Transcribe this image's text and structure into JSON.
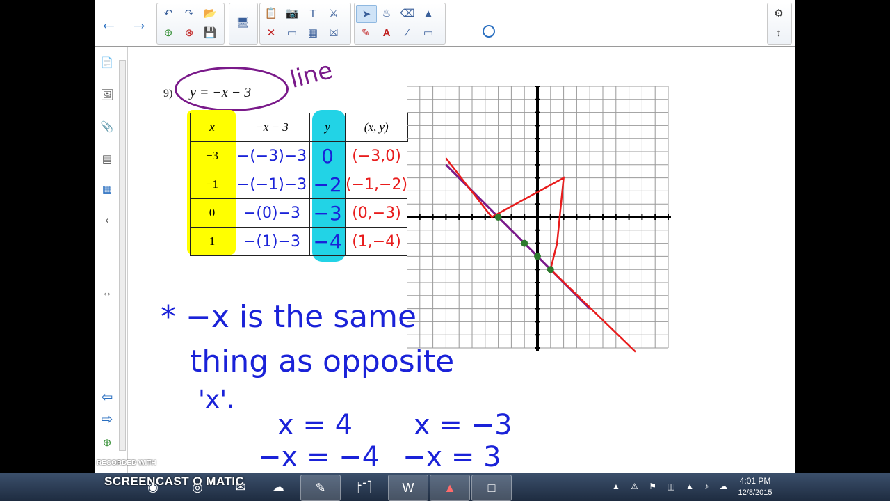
{
  "toolbar": {
    "nav": {
      "back_icon": "left-arrow-icon",
      "forward_icon": "right-arrow-icon"
    }
  },
  "problem": {
    "label": "9)",
    "equation": "y = −x − 3",
    "annotation": "line"
  },
  "table": {
    "headers": [
      "x",
      "−x − 3",
      "y",
      "(x, y)"
    ],
    "rows": [
      {
        "x": "−3",
        "work": "−(−3)−3",
        "y": "0",
        "point": "(−3,0)"
      },
      {
        "x": "−1",
        "work": "−(−1)−3",
        "y": "−2",
        "point": "(−1,−2)"
      },
      {
        "x": "0",
        "work": "−(0)−3",
        "y": "−3",
        "point": "(0,−3)"
      },
      {
        "x": "1",
        "work": "−(1)−3",
        "y": "−4",
        "point": "(1,−4)"
      }
    ]
  },
  "note": {
    "line1": "* −x is the same",
    "line2": "thing as opposite",
    "line3": "'x'.",
    "ex1_a": "x = 4",
    "ex1_b": "−x = −4",
    "ex2_a": "x = −3",
    "ex2_b": "−x = 3"
  },
  "watermark": {
    "top": "RECORDED WITH",
    "bottom": "SCREENCAST O MATIC"
  },
  "taskbar": {
    "time": "4:01 PM",
    "date": "12/8/2015"
  },
  "colors": {
    "highlight_yellow": "#ffff00",
    "highlight_cyan": "#22d3e6",
    "ink_blue": "#1a22d8",
    "ink_red": "#e81c1c",
    "ink_purple": "#7a1a8a",
    "point_green": "#2d7a2d"
  }
}
